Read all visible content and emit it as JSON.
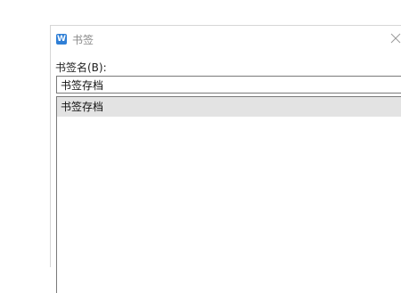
{
  "window": {
    "title": "书签",
    "app_icon_glyph": "W",
    "accent": "#2f7fd6"
  },
  "form": {
    "label": "书签名(B):",
    "name_value": "书签存档"
  },
  "bookmarks": {
    "items": [
      {
        "label": "书签存档",
        "selected": true
      }
    ]
  },
  "icons": {
    "app": "wps-writer-icon",
    "close": "close-icon"
  }
}
